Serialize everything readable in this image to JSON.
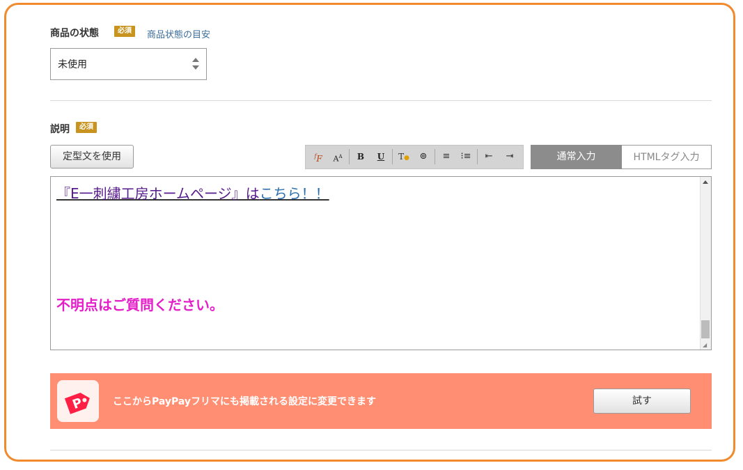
{
  "condition": {
    "label": "商品の状態",
    "required_badge": "必須",
    "guide_link": "商品状態の目安",
    "selected": "未使用"
  },
  "description": {
    "label": "説明",
    "required_badge": "必須",
    "template_button": "定型文を使用",
    "toolbar": [
      "font-family-icon",
      "font-size-icon",
      "bold-icon",
      "underline-icon",
      "text-color-icon",
      "link-icon",
      "align-icon",
      "list-icon",
      "outdent-icon",
      "indent-icon"
    ],
    "tabs": {
      "normal": "通常入力",
      "html": "HTMLタグ入力",
      "active": "normal"
    },
    "content": {
      "line1_part1": "『E一刺繍工房ホームページ』は",
      "line1_part2": "こちら！！",
      "line2": "不明点はご質問ください。",
      "magenta": "#e41fc8",
      "link_purple": "#551a8b",
      "link_blue": "#2a6fb0"
    }
  },
  "paypay_banner": {
    "message": "ここからPayPayフリマにも掲載される設定に変更できます",
    "try_button": "試す",
    "bg_color": "#ff8e73"
  },
  "colors": {
    "frame": "#f08a2c",
    "badge": "#c8941f",
    "active_tab": "#8c8c8c"
  }
}
